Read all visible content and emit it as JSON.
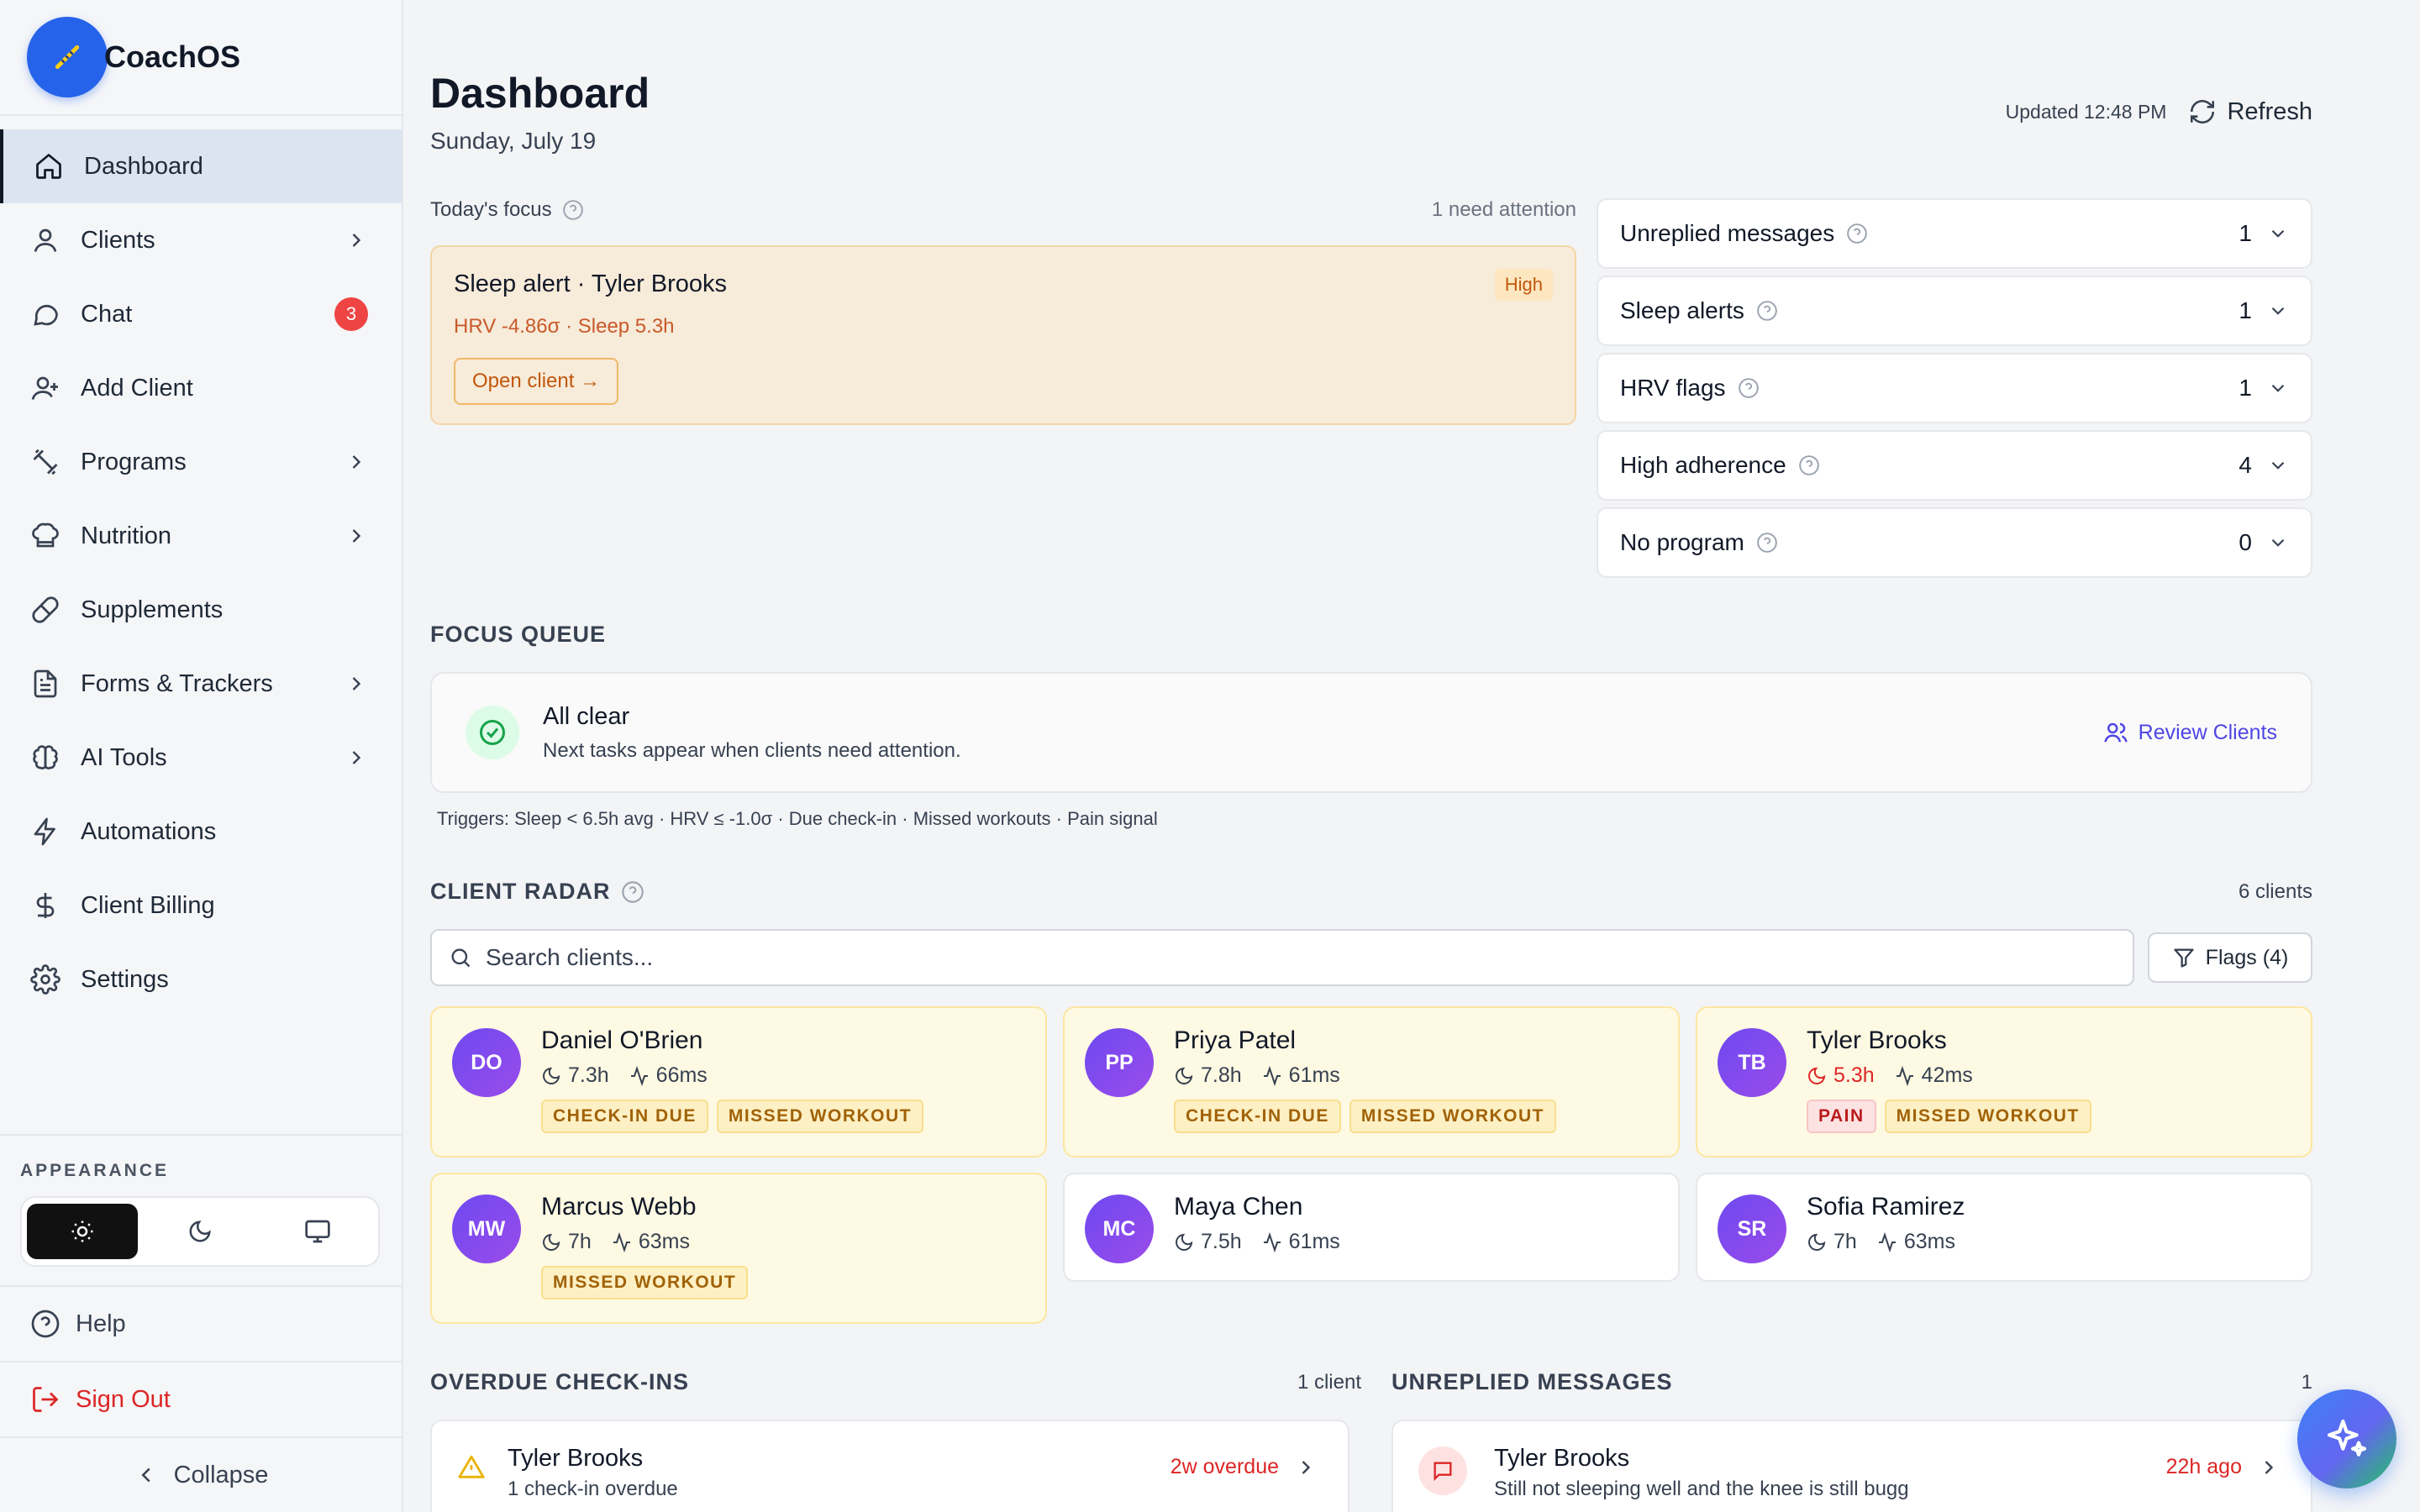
{
  "app": {
    "name": "CoachOS"
  },
  "sidebar": {
    "items": [
      {
        "label": "Dashboard"
      },
      {
        "label": "Clients"
      },
      {
        "label": "Chat",
        "badge": "3"
      },
      {
        "label": "Add Client"
      },
      {
        "label": "Programs"
      },
      {
        "label": "Nutrition"
      },
      {
        "label": "Supplements"
      },
      {
        "label": "Forms & Trackers"
      },
      {
        "label": "AI Tools"
      },
      {
        "label": "Automations"
      },
      {
        "label": "Client Billing"
      },
      {
        "label": "Settings"
      }
    ],
    "appearance_label": "APPEARANCE",
    "help": "Help",
    "sign_out": "Sign Out",
    "collapse": "Collapse"
  },
  "header": {
    "title": "Dashboard",
    "date": "Sunday, July 19",
    "updated": "Updated 12:48 PM",
    "refresh": "Refresh"
  },
  "focus": {
    "label": "Today's focus",
    "attention": "1 need attention",
    "alert": {
      "title": "Sleep alert · Tyler Brooks",
      "subtitle": "HRV -4.86σ · Sleep 5.3h",
      "tag": "High",
      "button": "Open client →"
    }
  },
  "metrics": [
    {
      "label": "Unreplied messages",
      "value": "1"
    },
    {
      "label": "Sleep alerts",
      "value": "1"
    },
    {
      "label": "HRV flags",
      "value": "1"
    },
    {
      "label": "High adherence",
      "value": "4"
    },
    {
      "label": "No program",
      "value": "0"
    }
  ],
  "queue": {
    "title": "FOCUS QUEUE",
    "status": "All clear",
    "description": "Next tasks appear when clients need attention.",
    "review_button": "Review Clients",
    "triggers": "Triggers: Sleep < 6.5h avg · HRV ≤ -1.0σ · Due check-in · Missed workouts · Pain signal"
  },
  "radar": {
    "title": "CLIENT RADAR",
    "count": "6 clients",
    "search_placeholder": "Search clients...",
    "flags_button": "Flags (4)",
    "clients": [
      {
        "initials": "DO",
        "name": "Daniel O'Brien",
        "sleep": "7.3h",
        "hrv": "66ms",
        "tags": [
          "CHECK-IN DUE",
          "MISSED WORKOUT"
        ]
      },
      {
        "initials": "PP",
        "name": "Priya Patel",
        "sleep": "7.8h",
        "hrv": "61ms",
        "tags": [
          "CHECK-IN DUE",
          "MISSED WORKOUT"
        ]
      },
      {
        "initials": "TB",
        "name": "Tyler Brooks",
        "sleep": "5.3h",
        "hrv": "42ms",
        "tags": [
          "PAIN",
          "MISSED WORKOUT"
        ]
      },
      {
        "initials": "MW",
        "name": "Marcus Webb",
        "sleep": "7h",
        "hrv": "63ms",
        "tags": [
          "MISSED WORKOUT"
        ]
      },
      {
        "initials": "MC",
        "name": "Maya Chen",
        "sleep": "7.5h",
        "hrv": "61ms",
        "tags": []
      },
      {
        "initials": "SR",
        "name": "Sofia Ramirez",
        "sleep": "7h",
        "hrv": "63ms",
        "tags": []
      }
    ]
  },
  "overdue": {
    "title": "OVERDUE CHECK-INS",
    "count": "1 client",
    "item": {
      "name": "Tyler Brooks",
      "detail": "1 check-in overdue",
      "status": "2w overdue"
    }
  },
  "unreplied": {
    "title": "UNREPLIED MESSAGES",
    "count": "1",
    "item": {
      "name": "Tyler Brooks",
      "message": "Still not sleeping well and the knee is still bugg",
      "time": "22h ago"
    }
  },
  "colors": {
    "accent": "#2563eb",
    "alert_bg": "#f7ebd9",
    "flag_bg": "#fef9e3",
    "danger": "#dc2626",
    "avatar": "#7c4dee"
  }
}
